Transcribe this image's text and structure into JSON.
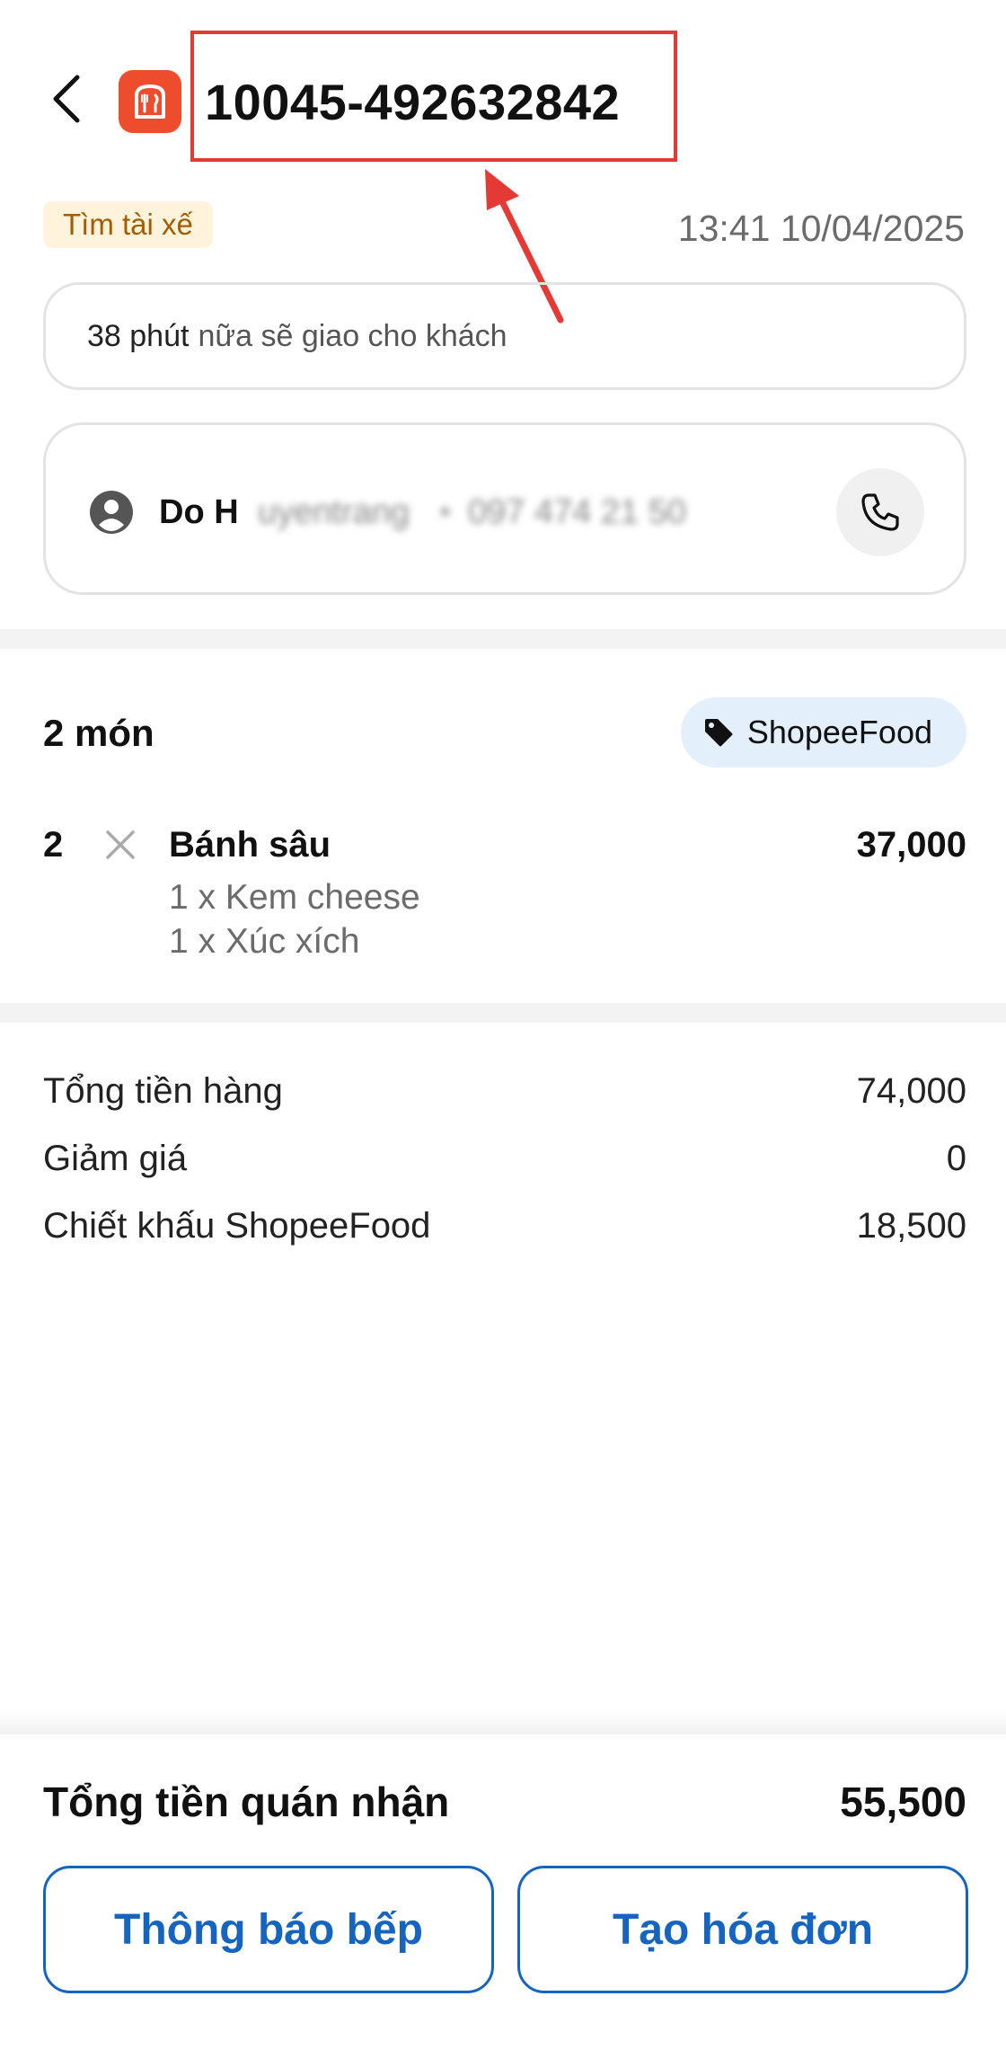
{
  "header": {
    "order_id": "10045-492632842",
    "back_icon": "chevron-left-icon",
    "app_icon": "shopeefood-logo-icon",
    "accent_color": "#ee4d2d",
    "highlight_color": "#e53935"
  },
  "status": {
    "badge": "Tìm tài xế",
    "timestamp": "13:41 10/04/2025"
  },
  "eta": {
    "strong": "38 phút",
    "rest": "nữa sẽ giao cho khách"
  },
  "customer": {
    "name_visible": "Do H",
    "name_blurred": "uyentrang",
    "phone_blurred": "097 474 21 50",
    "icon": "user-circle-icon",
    "call_icon": "phone-icon"
  },
  "order": {
    "items_count": "2 món",
    "platform": "ShopeeFood",
    "platform_icon": "tag-icon",
    "items": [
      {
        "qty": "2",
        "name": "Bánh sâu",
        "price": "37,000",
        "options": [
          "1 x Kem cheese",
          "1 x Xúc xích"
        ]
      }
    ]
  },
  "summary": [
    {
      "label": "Tổng tiền hàng",
      "value": "74,000"
    },
    {
      "label": "Giảm giá",
      "value": "0"
    },
    {
      "label": "Chiết khấu ShopeeFood",
      "value": "18,500"
    }
  ],
  "total": {
    "label": "Tổng tiền quán nhận",
    "value": "55,500"
  },
  "actions": {
    "kitchen_label": "Thông báo bếp",
    "invoice_label": "Tạo hóa đơn",
    "primary_color": "#1565c0"
  }
}
